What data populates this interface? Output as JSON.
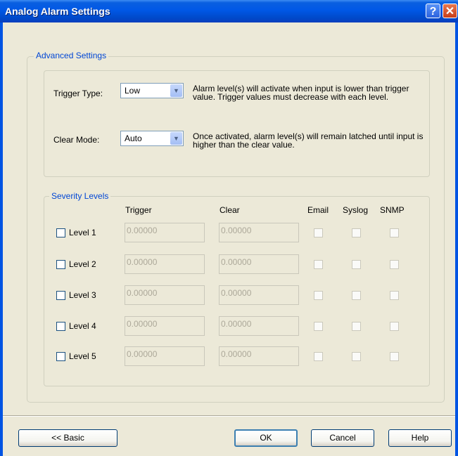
{
  "window": {
    "title": "Analog Alarm Settings",
    "help_glyph": "?",
    "close_glyph": "✕"
  },
  "advanced": {
    "legend": "Advanced Settings",
    "trigger_type_label": "Trigger Type:",
    "trigger_type_value": "Low",
    "trigger_type_desc": "Alarm level(s) will activate when input is lower than trigger value.  Trigger values must decrease with each level.",
    "clear_mode_label": "Clear Mode:",
    "clear_mode_value": "Auto",
    "clear_mode_desc": "Once activated, alarm level(s) will remain latched until input is higher than the clear value."
  },
  "severity": {
    "legend": "Severity Levels",
    "columns": {
      "trigger": "Trigger",
      "clear": "Clear",
      "email": "Email",
      "syslog": "Syslog",
      "snmp": "SNMP"
    },
    "levels": [
      {
        "label": "Level 1",
        "trigger": "0.00000",
        "clear": "0.00000",
        "checked": false
      },
      {
        "label": "Level 2",
        "trigger": "0.00000",
        "clear": "0.00000",
        "checked": false
      },
      {
        "label": "Level 3",
        "trigger": "0.00000",
        "clear": "0.00000",
        "checked": false
      },
      {
        "label": "Level 4",
        "trigger": "0.00000",
        "clear": "0.00000",
        "checked": false
      },
      {
        "label": "Level 5",
        "trigger": "0.00000",
        "clear": "0.00000",
        "checked": false
      }
    ]
  },
  "buttons": {
    "basic": "<< Basic",
    "ok": "OK",
    "cancel": "Cancel",
    "help": "Help"
  }
}
